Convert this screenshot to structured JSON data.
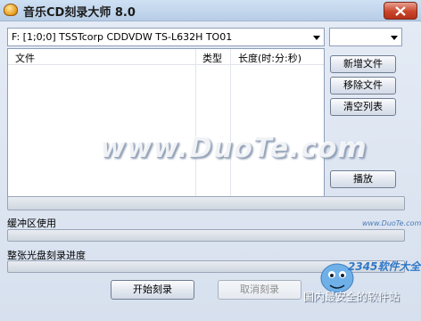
{
  "window": {
    "title": "音乐CD刻录大师 8.0"
  },
  "drive_select": {
    "value": "F:  [1;0;0] TSSTcorp CDDVDW TS-L632H  TO01"
  },
  "speed_select": {
    "value": ""
  },
  "file_list": {
    "columns": [
      "文件",
      "类型",
      "长度(时:分:秒)"
    ],
    "rows": []
  },
  "buttons": {
    "add": "新增文件",
    "remove": "移除文件",
    "clear": "清空列表",
    "play": "播放",
    "start": "开始刻录",
    "cancel": "取消刻录"
  },
  "labels": {
    "buffer": "缓冲区使用",
    "disc_progress": "整张光盘刻录进度"
  },
  "progress": {
    "track": 0,
    "buffer": 0,
    "disc": 0
  },
  "watermark": {
    "site": "www.DuoTe.com",
    "small_url": "www.DuoTe.com",
    "brand": "2345软件大全",
    "slogan": "国内最安全的软件站"
  }
}
